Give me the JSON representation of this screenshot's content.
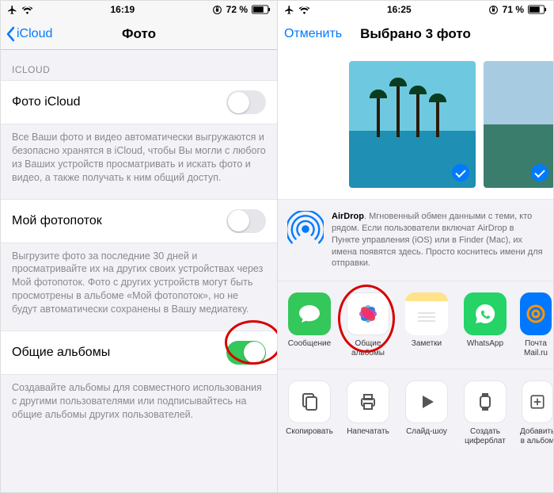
{
  "left": {
    "status": {
      "time": "16:19",
      "battery": "72 %"
    },
    "nav": {
      "back": "iCloud",
      "title": "Фото"
    },
    "section_header": "ICLOUD",
    "rows": {
      "icloud_photo": {
        "label": "Фото iCloud",
        "on": false
      },
      "photostream": {
        "label": "Мой фотопоток",
        "on": false
      },
      "shared": {
        "label": "Общие альбомы",
        "on": true
      }
    },
    "footers": {
      "icloud_photo": "Все Ваши фото и видео автоматически выгружаются и безопасно хранятся в iCloud, чтобы Вы могли с любого из Ваших устройств просматривать и искать фото и видео, а также получать к ним общий доступ.",
      "photostream": "Выгрузите фото за последние 30 дней и просматривайте их на других своих устройствах через Мой фотопоток. Фото с других устройств могут быть просмотрены в альбоме «Мой фотопоток», но не будут автоматически сохранены в Вашу медиатеку.",
      "shared": "Создавайте альбомы для совместного использования с другими пользователями или подписывайтесь на общие альбомы других пользователей."
    }
  },
  "right": {
    "status": {
      "time": "16:25",
      "battery": "71 %"
    },
    "nav": {
      "cancel": "Отменить",
      "title": "Выбрано 3 фото"
    },
    "airdrop": {
      "bold": "AirDrop",
      "text": ". Мгновенный обмен данными с теми, кто рядом. Если пользователи включат AirDrop в Пункте управления (iOS) или в Finder (Mac), их имена появятся здесь. Просто коснитесь имени для отправки."
    },
    "apps": [
      {
        "name": "messages",
        "label": "Сообщение",
        "color": "#34c759"
      },
      {
        "name": "shared-albums",
        "label": "Общие альбомы",
        "color": "#ffffff"
      },
      {
        "name": "notes",
        "label": "Заметки",
        "color": "#ffffff"
      },
      {
        "name": "whatsapp",
        "label": "WhatsApp",
        "color": "#25d366"
      },
      {
        "name": "mailru",
        "label": "Почта Mail.ru",
        "color": "#0077ff"
      }
    ],
    "actions": [
      {
        "name": "copy",
        "label": "Скопировать"
      },
      {
        "name": "print",
        "label": "Напечатать"
      },
      {
        "name": "slideshow",
        "label": "Слайд-шоу"
      },
      {
        "name": "watchface",
        "label": "Создать циферблат"
      },
      {
        "name": "add-to-album",
        "label": "Добавить в альбом"
      }
    ]
  }
}
